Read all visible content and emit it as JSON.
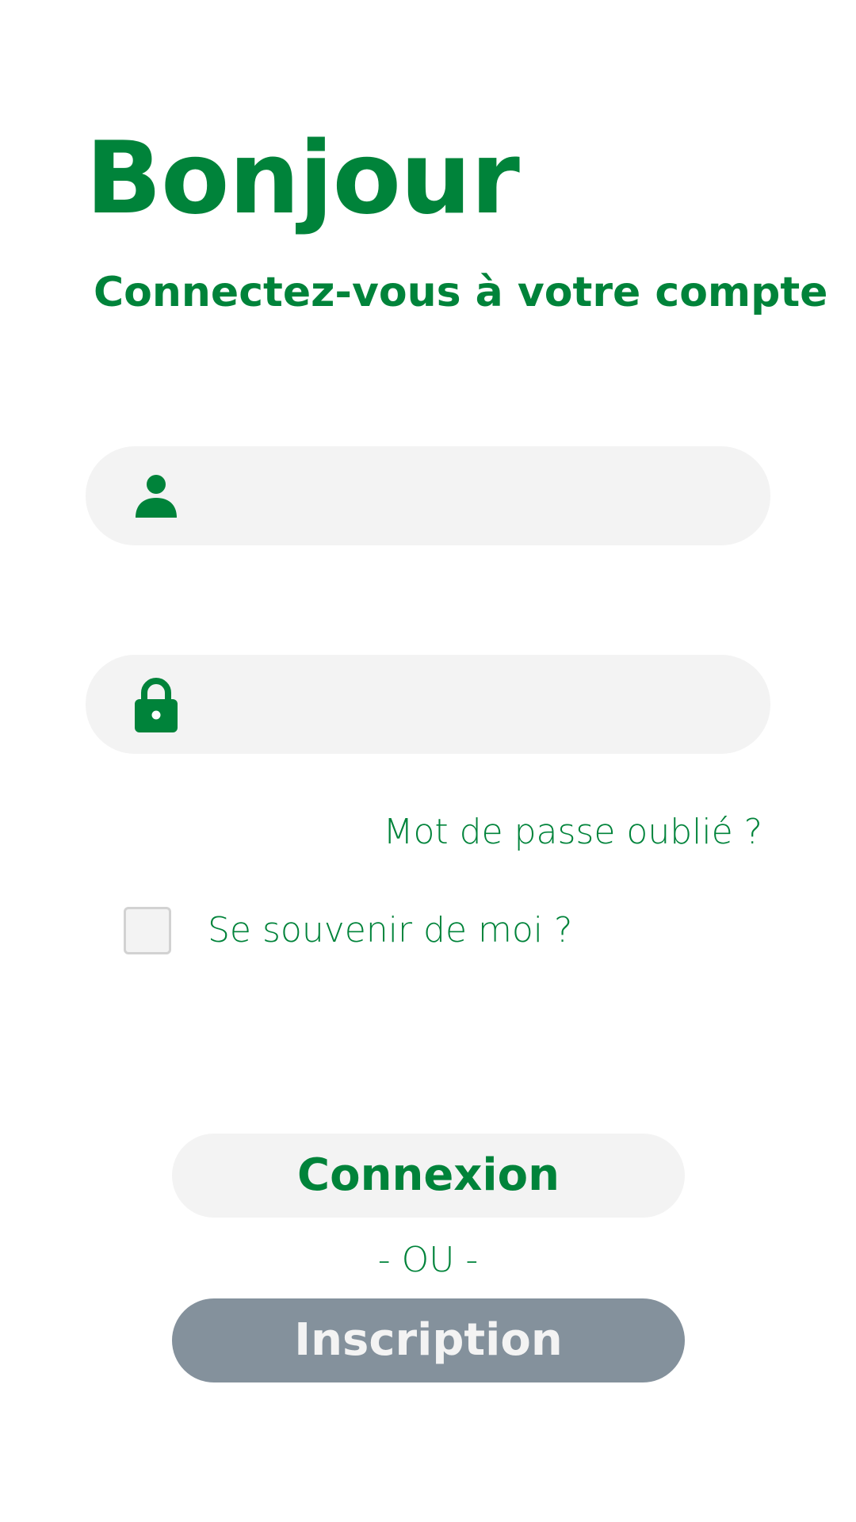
{
  "header": {
    "title": "Bonjour",
    "subtitle": "Connectez-vous à votre compte"
  },
  "form": {
    "username": {
      "icon": "user-icon",
      "value": "",
      "placeholder": ""
    },
    "password": {
      "icon": "lock-icon",
      "value": "",
      "placeholder": ""
    },
    "forgot_password_label": "Mot de passe oublié ?",
    "remember_me_label": "Se souvenir de moi ?",
    "remember_me_checked": false
  },
  "actions": {
    "login_label": "Connexion",
    "separator": "- OU -",
    "signup_label": "Inscription"
  },
  "colors": {
    "accent": "#00833a",
    "field_background": "#f3f3f3",
    "signup_background": "#84919c"
  }
}
